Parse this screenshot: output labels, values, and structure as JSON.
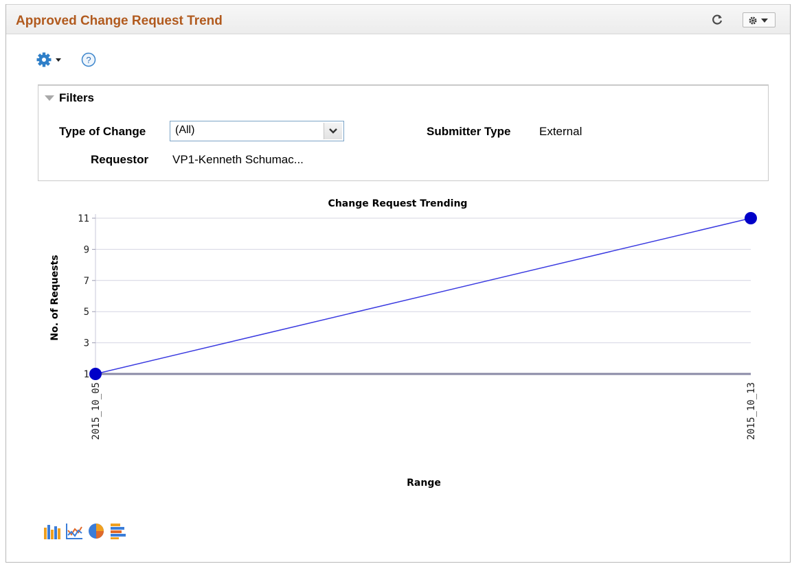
{
  "header": {
    "title": "Approved Change Request Trend",
    "refresh_icon": "refresh-icon",
    "actions_icon": "gear-dropdown-icon"
  },
  "toolbar": {
    "gear_icon": "gear-icon",
    "help_icon": "help-icon",
    "help_glyph": "?"
  },
  "filters": {
    "title": "Filters",
    "type_of_change_label": "Type of Change",
    "type_of_change_value": "(All)",
    "submitter_type_label": "Submitter Type",
    "submitter_type_value": "External",
    "requestor_label": "Requestor",
    "requestor_value": "VP1-Kenneth Schumac..."
  },
  "chart_data": {
    "type": "line",
    "title": "Change Request Trending",
    "xlabel": "Range",
    "ylabel": "No. of Requests",
    "categories": [
      "2015_10_05",
      "2015_10_13"
    ],
    "values": [
      1,
      11
    ],
    "yticks": [
      1,
      3,
      5,
      7,
      9,
      11
    ],
    "ylim": [
      1,
      11
    ],
    "grid": true,
    "line_color": "#3a3ae0",
    "marker_color": "#0000c8"
  },
  "chart_type_icons": [
    "bar-chart-icon",
    "line-chart-icon",
    "pie-chart-icon",
    "horizontal-bar-chart-icon"
  ],
  "colors": {
    "title": "#b15a1e",
    "accent": "#2f7fc8"
  }
}
